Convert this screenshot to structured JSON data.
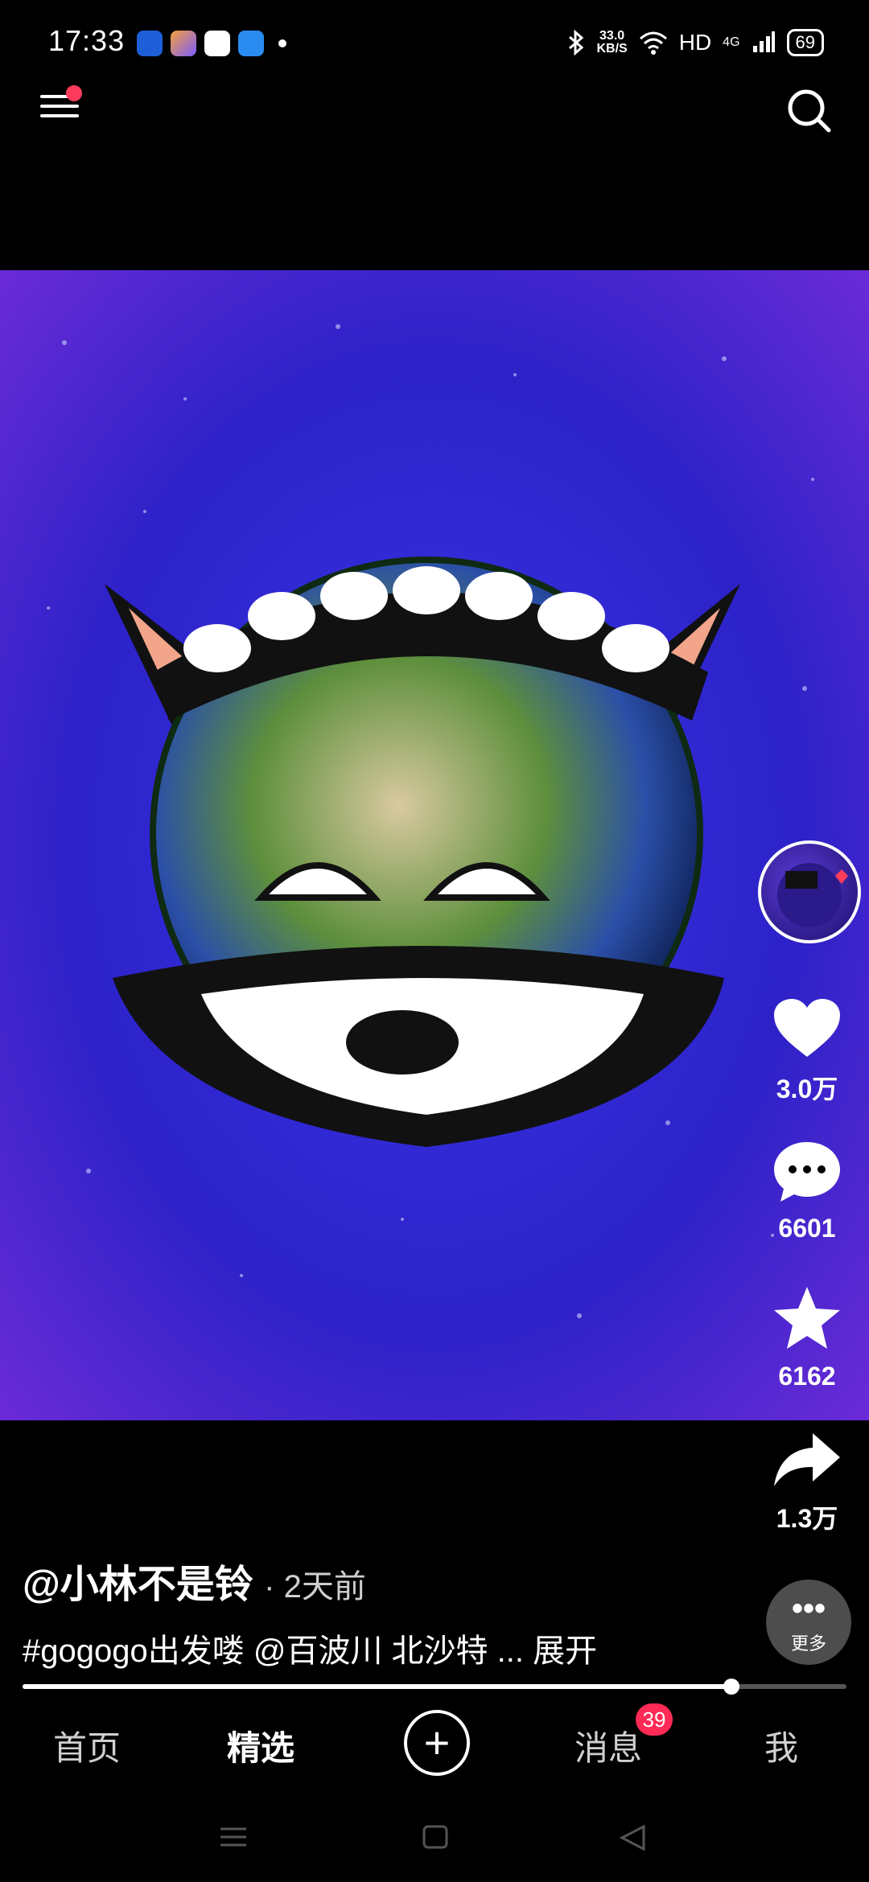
{
  "status": {
    "time": "17:33",
    "net_speed_top": "33.0",
    "net_speed_unit": "KB/S",
    "hd": "HD",
    "signal_4g": "4G",
    "battery": "69"
  },
  "post": {
    "author": "@小林不是铃",
    "age": "· 2天前",
    "description": "#gogogo出发喽 @百波川 北沙特 ... 展开"
  },
  "actions": {
    "like_count": "3.0万",
    "comment_count": "6601",
    "favorite_count": "6162",
    "share_count": "1.3万",
    "more_label": "更多"
  },
  "progress": {
    "value": 0.86
  },
  "tabs": {
    "home": "首页",
    "featured": "精选",
    "create": "+",
    "messages": "消息",
    "messages_badge": "39",
    "me": "我"
  },
  "colors": {
    "badge": "#ff2a55",
    "menu_dot": "#ff3b5c",
    "background": "#000000"
  }
}
